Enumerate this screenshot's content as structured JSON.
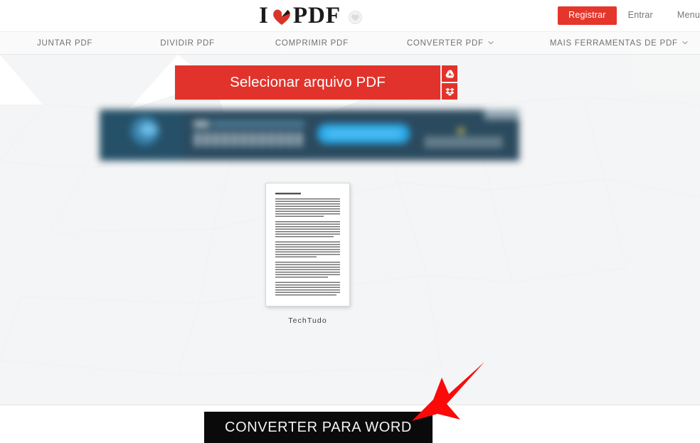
{
  "header": {
    "logo": {
      "text_left": "I",
      "text_right": "PDF",
      "heart_icon": "heart-icon",
      "badge_icon": "logo-badge-icon"
    },
    "actions": {
      "register_label": "Registrar",
      "login_label": "Entrar",
      "menu_label": "Menu",
      "register_color": "#e5362b"
    }
  },
  "nav": {
    "items": [
      {
        "label": "JUNTAR PDF",
        "has_caret": false
      },
      {
        "label": "DIVIDIR PDF",
        "has_caret": false
      },
      {
        "label": "COMPRIMIR PDF",
        "has_caret": false
      },
      {
        "label": "CONVERTER PDF",
        "has_caret": true
      },
      {
        "label": "MAIS FERRAMENTAS DE PDF",
        "has_caret": true
      }
    ]
  },
  "main": {
    "select_button_label": "Selecionar arquivo PDF",
    "select_button_color": "#e1332b",
    "cloud_buttons": [
      {
        "icon": "google-drive-icon",
        "name": "google-drive-upload-button"
      },
      {
        "icon": "dropbox-icon",
        "name": "dropbox-upload-button"
      }
    ],
    "ad_banner": {
      "description": "blurred-advertisement-banner",
      "background_color": "#2b4a5e",
      "cta_color": "#29a8e8"
    },
    "file_thumbnail": {
      "caption": "TechTudo",
      "doc_heading": "Transpose o TechTudo"
    }
  },
  "footer": {
    "convert_button_label": "CONVERTER PARA WORD",
    "convert_button_color": "#0a0a0a"
  },
  "annotation": {
    "arrow_color": "#fb0a0a",
    "arrow_name": "red-pointer-arrow"
  }
}
